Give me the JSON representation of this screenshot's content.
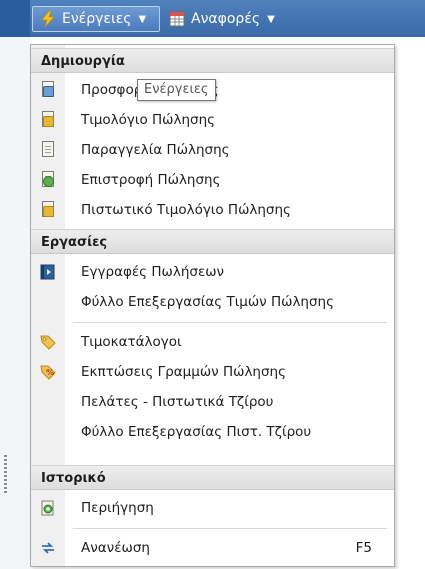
{
  "menubar": {
    "actions_label": "Ενέργειες",
    "reports_label": "Αναφορές"
  },
  "tooltip": "Ενέργειες",
  "sections": {
    "create": "Δημιουργία",
    "tasks": "Εργασίες",
    "history": "Ιστορικό"
  },
  "create_items": [
    {
      "label": "Προσφορά Πώλησης",
      "icon": "quote-document-icon"
    },
    {
      "label": "Τιμολόγιο Πώλησης",
      "icon": "invoice-document-icon"
    },
    {
      "label": "Παραγγελία Πώλησης",
      "icon": "order-document-icon"
    },
    {
      "label": "Επιστροφή Πώλησης",
      "icon": "return-document-icon"
    },
    {
      "label": "Πιστωτικό Τιμολόγιο Πώλησης",
      "icon": "credit-memo-document-icon"
    }
  ],
  "task_items": [
    {
      "label": "Εγγραφές Πωλήσεων",
      "icon": "journal-book-icon"
    },
    {
      "label": "Φύλλο Επεξεργασίας Τιμών Πώλησης",
      "icon": ""
    },
    {
      "label": "Τιμοκατάλογοι",
      "icon": "price-tag-icon"
    },
    {
      "label": "Εκπτώσεις Γραμμών Πώλησης",
      "icon": "discount-tag-icon"
    },
    {
      "label": "Πελάτες - Πιστωτικά Τζίρου",
      "icon": ""
    },
    {
      "label": "Φύλλο Επεξεργασίας Πιστ. Τζίρου",
      "icon": ""
    }
  ],
  "history_items": [
    {
      "label": "Περιήγηση",
      "icon": "navigate-icon"
    },
    {
      "label": "Ανανέωση",
      "icon": "refresh-icon",
      "shortcut": "F5"
    }
  ],
  "colors": {
    "menubar": "#4f81bd",
    "section_header": "#e4e4e4",
    "lightning": "#f5c518"
  }
}
